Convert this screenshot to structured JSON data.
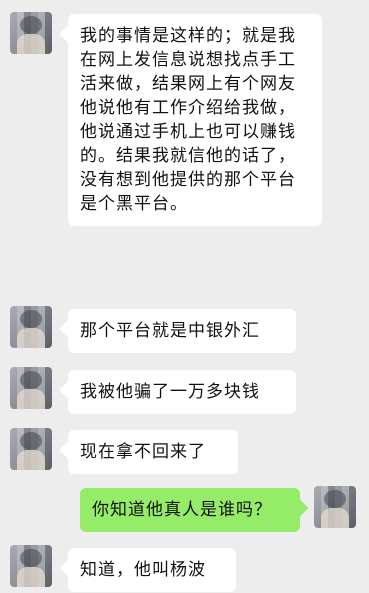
{
  "messages": [
    {
      "side": "left",
      "text": "我的事情是这样的；就是我在网上发信息说想找点手工活来做，结果网上有个网友他说他有工作介绍给我做，他说通过手机上也可以赚钱的。结果我就信他的话了，没有想到他提供的那个平台是个黑平台。"
    },
    {
      "side": "left",
      "text": "那个平台就是中银外汇"
    },
    {
      "side": "left",
      "text": "我被他骗了一万多块钱"
    },
    {
      "side": "left",
      "text": "现在拿不回来了"
    },
    {
      "side": "right",
      "text": "你知道他真人是谁吗？"
    },
    {
      "side": "left",
      "text": "知道，他叫杨波"
    }
  ]
}
